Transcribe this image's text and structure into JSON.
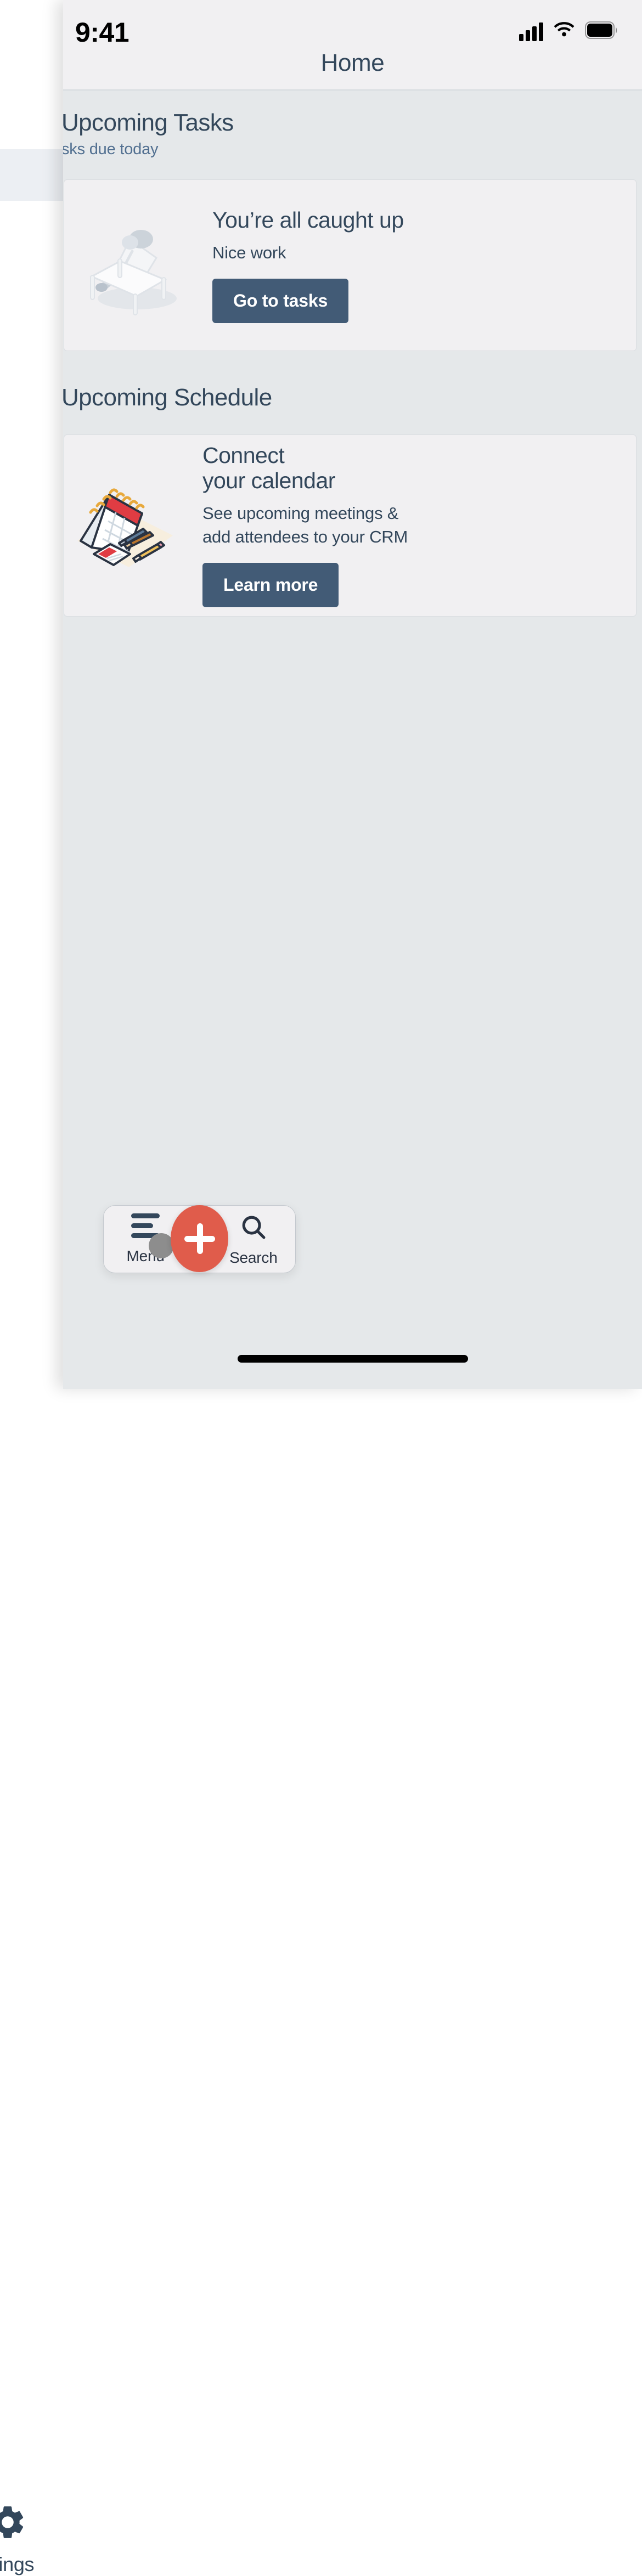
{
  "status_bar": {
    "time": "9:41",
    "cellular_icon": "cellular-signal-icon",
    "wifi_icon": "wifi-icon",
    "battery_icon": "battery-full-icon"
  },
  "nav_header": {
    "title": "Home"
  },
  "drawer": {
    "settings_label": "ttings",
    "settings_icon": "gear-icon"
  },
  "sections": [
    {
      "title": "Upcoming Tasks",
      "subtitle": "sks due today",
      "card": {
        "illustration": "person-relaxing-lounge-chair-illustration",
        "title": "You’re all caught up",
        "subtitle": "Nice work",
        "button_label": "Go to tasks"
      }
    },
    {
      "title": "Upcoming Schedule",
      "subtitle": "",
      "card": {
        "illustration": "desk-calendar-pens-notepad-illustration",
        "title_line1": "Connect",
        "title_line2": "your calendar",
        "subtitle_line1": "See upcoming meetings &",
        "subtitle_line2": "add attendees to your CRM",
        "button_label": "Learn more"
      }
    }
  ],
  "bottom_nav": {
    "menu_label": "Menu",
    "menu_icon": "hamburger-menu-icon",
    "menu_badge_icon": "avatar-badge-icon",
    "create_icon": "plus-icon",
    "search_label": "Search",
    "search_icon": "search-icon"
  },
  "colors": {
    "accent_red": "#e05c4b",
    "button_slate": "#425b76",
    "text_dark": "#33475b",
    "text_muted": "#516f90",
    "app_background": "#e5e8ea",
    "card_background": "#f1f0f2"
  }
}
